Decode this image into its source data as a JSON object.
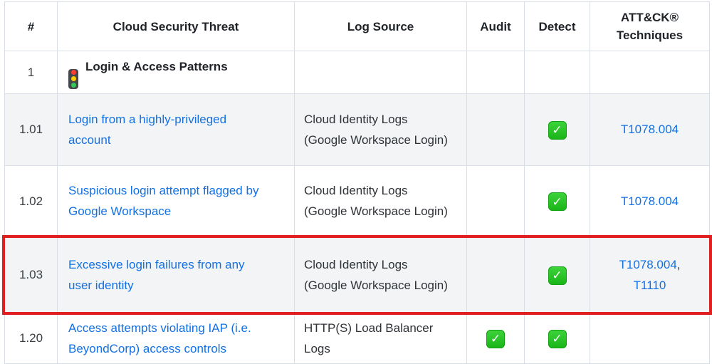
{
  "colors": {
    "link": "#1270e3",
    "border": "#d8dee4",
    "stripe": "#f2f4f6",
    "header_text": "#1f2328",
    "body_text": "#2f3237",
    "highlight": "#e02020",
    "check_green": "#28c428"
  },
  "highlight": {
    "row_num": "1.03"
  },
  "icons": {
    "section": "traffic-light-icon",
    "check": "check-icon",
    "check_glyph": "✓"
  },
  "table": {
    "columns": [
      {
        "key": "num",
        "label": "#"
      },
      {
        "key": "threat",
        "label": "Cloud Security Threat"
      },
      {
        "key": "log_source",
        "label": "Log Source"
      },
      {
        "key": "audit",
        "label": "Audit"
      },
      {
        "key": "detect",
        "label": "Detect"
      },
      {
        "key": "techniques",
        "label": "ATT&CK® Techniques"
      }
    ],
    "rows": [
      {
        "num": "1",
        "kind": "section",
        "threat": "Login & Access Patterns",
        "log_source": "",
        "audit": false,
        "detect": false,
        "techniques": []
      },
      {
        "num": "1.01",
        "kind": "item",
        "threat": "Login from a highly-privileged account",
        "log_source": "Cloud Identity Logs (Google Workspace Login)",
        "audit": false,
        "detect": true,
        "techniques": [
          "T1078.004"
        ]
      },
      {
        "num": "1.02",
        "kind": "item",
        "threat": "Suspicious login attempt flagged by Google Workspace",
        "log_source": "Cloud Identity Logs (Google Workspace Login)",
        "audit": false,
        "detect": true,
        "techniques": [
          "T1078.004"
        ]
      },
      {
        "num": "1.03",
        "kind": "item",
        "threat": "Excessive login failures from any user identity",
        "log_source": "Cloud Identity Logs (Google Workspace Login)",
        "audit": false,
        "detect": true,
        "techniques": [
          "T1078.004",
          "T1110"
        ]
      },
      {
        "num": "1.20",
        "kind": "item",
        "threat": "Access attempts violating IAP (i.e. BeyondCorp) access controls",
        "log_source": "HTTP(S) Load Balancer Logs",
        "audit": true,
        "detect": true,
        "techniques": []
      }
    ]
  }
}
